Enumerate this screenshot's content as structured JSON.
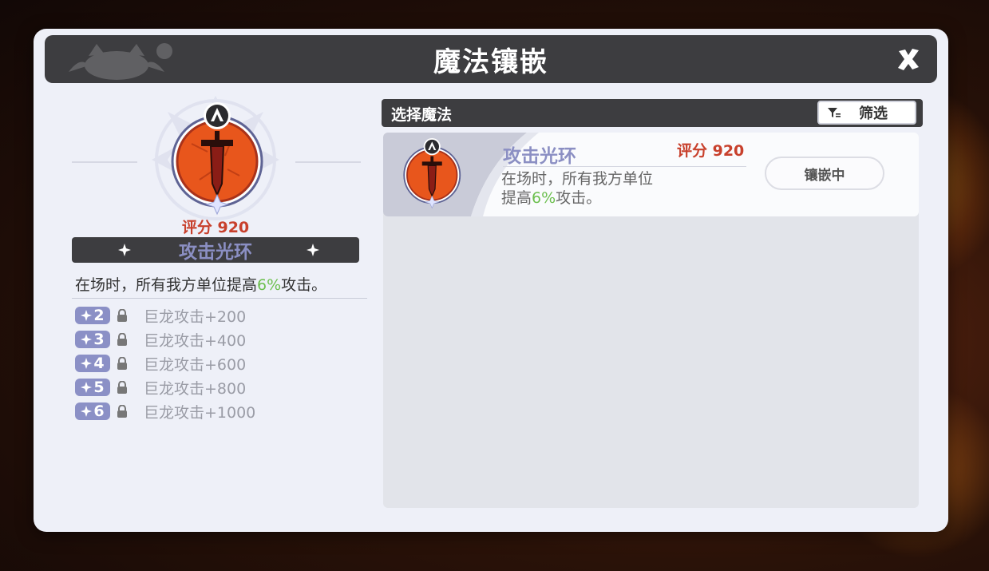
{
  "window": {
    "title": "魔法镶嵌"
  },
  "left_panel": {
    "score": "评分 920",
    "magic_name": "攻击光环",
    "description_prefix": "在场时，所有我方单位提高",
    "description_pct": "6%",
    "description_suffix": "攻击。",
    "bonuses": [
      {
        "level": "2",
        "text": "巨龙攻击+200"
      },
      {
        "level": "3",
        "text": "巨龙攻击+400"
      },
      {
        "level": "4",
        "text": "巨龙攻击+600"
      },
      {
        "level": "5",
        "text": "巨龙攻击+800"
      },
      {
        "level": "6",
        "text": "巨龙攻击+1000"
      }
    ]
  },
  "right_panel": {
    "header": "选择魔法",
    "filter_label": "筛选",
    "cards": [
      {
        "name": "攻击光环",
        "score": "评分 920",
        "desc_line1": "在场时，所有我方单位",
        "desc_line2_prefix": "提高",
        "desc_line2_pct": "6%",
        "desc_line2_suffix": "攻击。",
        "button": "镶嵌中"
      }
    ]
  },
  "colors": {
    "accent_text": "#8b8fc3",
    "score_red": "#c8402c",
    "percent_green": "#6cbf4e",
    "dark_bar": "#3d3d40",
    "panel_bg": "#eef0f8"
  },
  "icons": {
    "close": "close-icon",
    "filter": "filter-icon",
    "lock": "lock-icon",
    "sword_emblem": "sword-emblem-icon",
    "tier_badge": "a-tier-icon",
    "sparkle": "sparkle-icon"
  }
}
